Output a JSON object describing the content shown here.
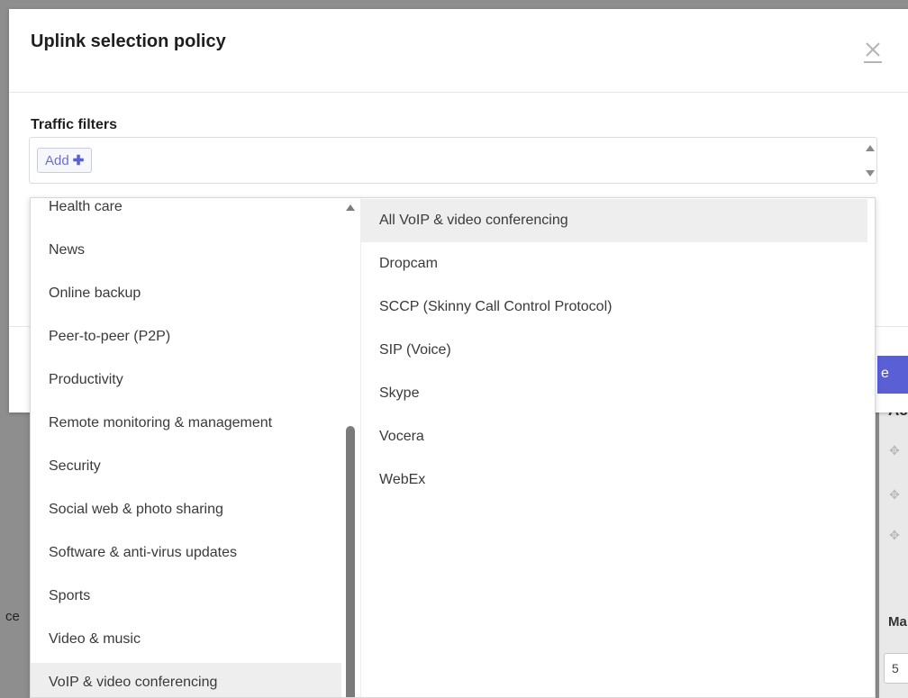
{
  "modal": {
    "title": "Uplink selection policy",
    "close_icon": "close-icon"
  },
  "traffic_filters": {
    "label": "Traffic filters",
    "add_label": "Add",
    "add_icon": "plus-icon"
  },
  "categories": {
    "selected_index": 11,
    "items": [
      "Health care",
      "News",
      "Online backup",
      "Peer-to-peer (P2P)",
      "Productivity",
      "Remote monitoring & management",
      "Security",
      "Social web & photo sharing",
      "Software & anti-virus updates",
      "Sports",
      "Video & music",
      "VoIP & video conferencing"
    ]
  },
  "applications": {
    "selected_index": 0,
    "items": [
      "All VoIP & video conferencing",
      "Dropcam",
      "SCCP (Skinny Call Control Protocol)",
      "SIP (Voice)",
      "Skype",
      "Vocera",
      "WebEx"
    ]
  },
  "background": {
    "header_fragment": "Ac",
    "button_fragment": "e",
    "label_fragment": "Ma",
    "input_value": "5",
    "left_fragment": "ce",
    "handle_icon": "drag-handle-icon",
    "accent_color": "#5a5fd6"
  }
}
